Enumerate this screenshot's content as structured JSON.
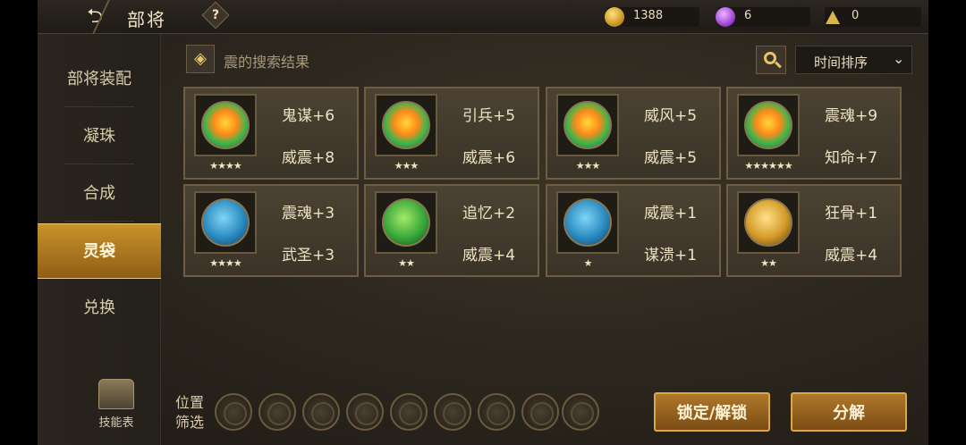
{
  "topbar": {
    "back_icon": "back-arrow-icon",
    "title": "部将",
    "help_label": "?",
    "coins": "1388",
    "gems": "6",
    "bells": "0"
  },
  "sidebar": {
    "items": [
      {
        "label": "部将装配"
      },
      {
        "label": "凝珠"
      },
      {
        "label": "合成"
      },
      {
        "label": "灵袋"
      },
      {
        "label": "兑换"
      }
    ],
    "active": "灵袋",
    "skill_book_label": "技能表"
  },
  "search": {
    "title": "震的搜索结果",
    "sort_label": "时间排序",
    "sort_chevron": "⌄"
  },
  "cards": [
    {
      "attr1": "鬼谋+6",
      "attr2": "威震+8",
      "stars": "★★★★",
      "orb": "rainbow"
    },
    {
      "attr1": "引兵+5",
      "attr2": "威震+6",
      "stars": "★★★",
      "orb": "rainbow"
    },
    {
      "attr1": "威风+5",
      "attr2": "威震+5",
      "stars": "★★★",
      "orb": "rainbow"
    },
    {
      "attr1": "震魂+9",
      "attr2": "知命+7",
      "stars": "★★★★★★",
      "orb": "rainbow"
    },
    {
      "attr1": "震魂+3",
      "attr2": "武圣+3",
      "stars": "★★★★",
      "orb": "blue"
    },
    {
      "attr1": "追忆+2",
      "attr2": "威震+4",
      "stars": "★★",
      "orb": "green"
    },
    {
      "attr1": "威震+1",
      "attr2": "谋溃+1",
      "stars": "★",
      "orb": "blue"
    },
    {
      "attr1": "狂骨+1",
      "attr2": "威震+4",
      "stars": "★★",
      "orb": "gold"
    }
  ],
  "filter": {
    "label_line1": "位置",
    "label_line2": "筛选"
  },
  "buttons": {
    "lock": "锁定/解锁",
    "decompose": "分解"
  },
  "colors": {
    "accent_gold": "#c9922c",
    "text": "#efe2c2"
  }
}
